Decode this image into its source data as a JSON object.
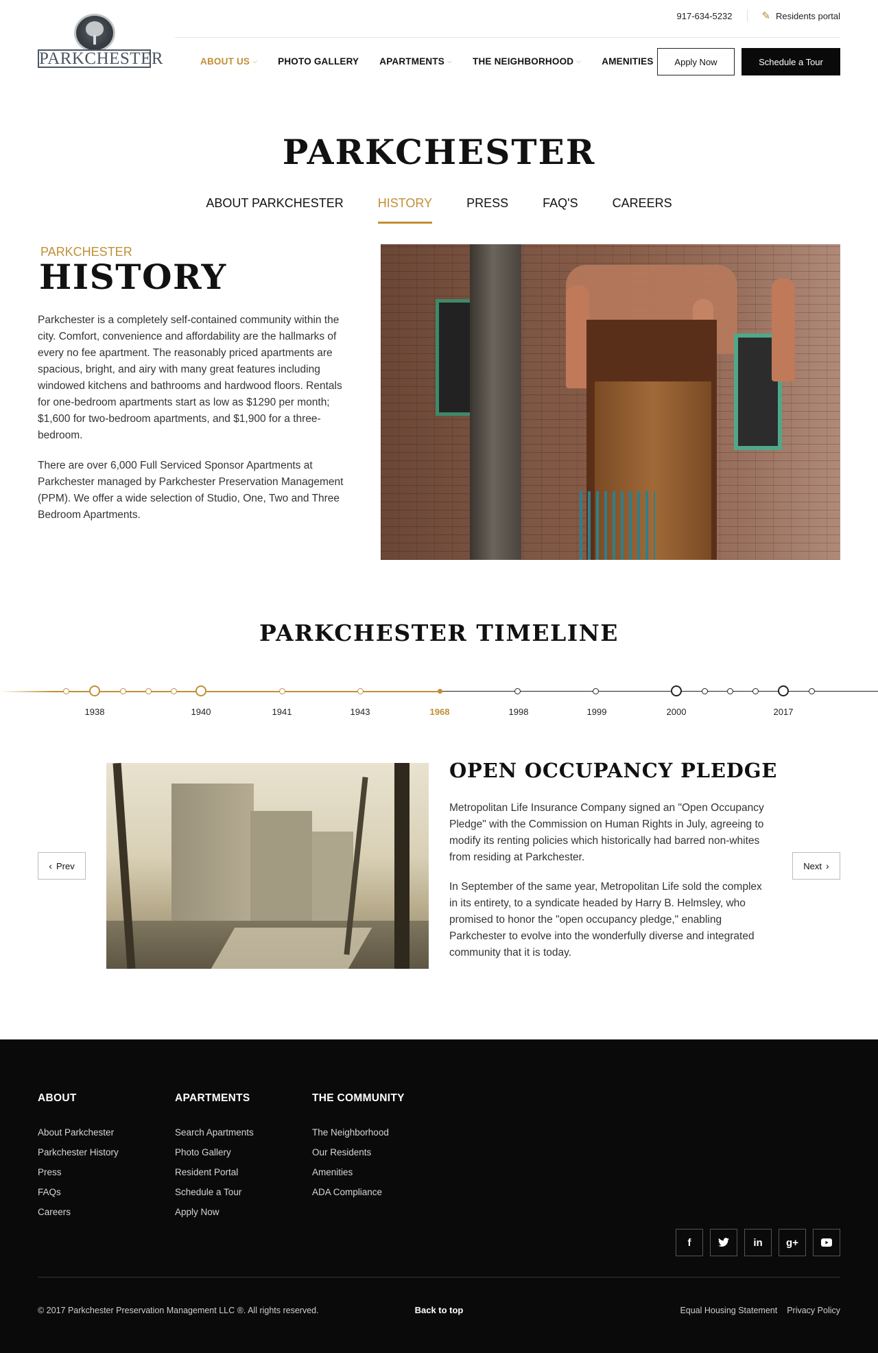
{
  "header": {
    "logo_text": "PARKCHESTER",
    "phone": "917-634-5232",
    "portal_label": "Residents portal",
    "nav": [
      {
        "label": "ABOUT US",
        "dropdown": true,
        "active": true
      },
      {
        "label": "PHOTO GALLERY",
        "dropdown": false
      },
      {
        "label": "APARTMENTS",
        "dropdown": true
      },
      {
        "label": "THE NEIGHBORHOOD",
        "dropdown": true
      },
      {
        "label": "AMENITIES",
        "dropdown": false
      }
    ],
    "apply_label": "Apply Now",
    "tour_label": "Schedule a Tour"
  },
  "page": {
    "title": "PARKCHESTER",
    "subnav": [
      "ABOUT PARKCHESTER",
      "HISTORY",
      "PRESS",
      "FAQ'S",
      "CAREERS"
    ],
    "active_subnav": "HISTORY"
  },
  "history": {
    "kicker": "PARKCHESTER",
    "heading": "HISTORY",
    "para1": "Parkchester is a completely self-contained community within the city. Comfort, convenience and affordability are the hallmarks of every no fee apartment. The reasonably priced apartments are spacious, bright, and airy with many great features including windowed kitchens and bathrooms and hardwood floors. Rentals for one-bedroom apartments start as low as $1290 per month; $1,600 for two-bedroom apartments, and $1,900 for a three-bedroom.",
    "para2": "There are over 6,000 Full Serviced Sponsor Apartments at Parkchester managed by Parkchester Preservation Management (PPM). We offer a wide selection of Studio, One, Two and Three Bedroom Apartments."
  },
  "timeline": {
    "title": "PARKCHESTER TIMELINE",
    "years": [
      "1938",
      "1940",
      "1941",
      "1943",
      "1968",
      "1998",
      "1999",
      "2000",
      "2017"
    ],
    "active_year": "1968",
    "event": {
      "title": "OPEN OCCUPANCY PLEDGE",
      "p1": "Metropolitan Life Insurance Company signed an \"Open Occupancy Pledge\" with the Commission on Human Rights in July, agreeing to modify its renting policies which historically had barred non-whites from residing at Parkchester.",
      "p2": "In September of the same year, Metropolitan Life sold the complex in its entirety, to a syndicate headed by Harry B. Helmsley, who promised to honor the \"open occupancy pledge,\" enabling Parkchester to evolve into the wonderfully diverse and integrated community that it is today."
    },
    "prev_label": "Prev",
    "next_label": "Next"
  },
  "footer": {
    "columns": [
      {
        "heading": "ABOUT",
        "links": [
          "About Parkchester",
          "Parkchester History",
          "Press",
          "FAQs",
          "Careers"
        ]
      },
      {
        "heading": "APARTMENTS",
        "links": [
          "Search Apartments",
          "Photo Gallery",
          "Resident Portal",
          "Schedule a Tour",
          "Apply Now"
        ]
      },
      {
        "heading": "THE COMMUNITY",
        "links": [
          "The Neighborhood",
          "Our Residents",
          "Amenities",
          "ADA Compliance"
        ]
      }
    ],
    "social": [
      "facebook-icon",
      "twitter-icon",
      "linkedin-icon",
      "google-plus-icon",
      "youtube-icon"
    ],
    "copyright": "© 2017 Parkchester Preservation Management LLC ®. All rights reserved.",
    "back_to_top": "Back to top",
    "legal_links": [
      "Equal Housing Statement",
      "Privacy Policy"
    ]
  },
  "colors": {
    "accent": "#c18f36",
    "footer_bg": "#0a0a0a",
    "text": "#222222"
  }
}
